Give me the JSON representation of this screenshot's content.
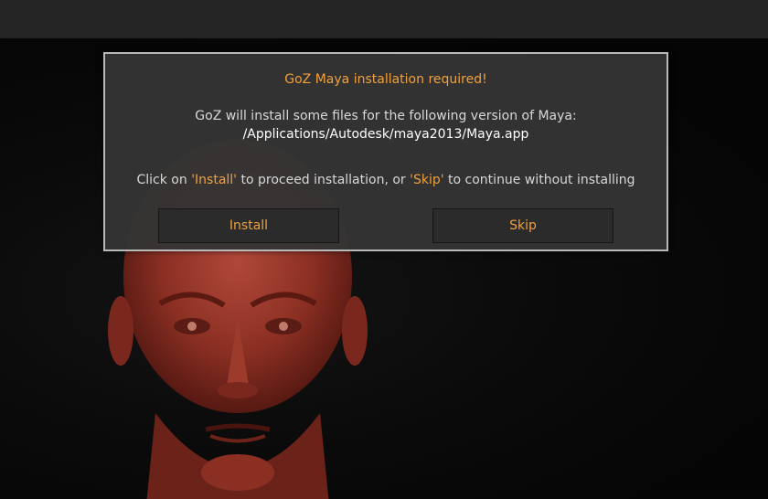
{
  "dialog": {
    "title": "GoZ Maya installation required!",
    "message": "GoZ will install some files for the following version of Maya:",
    "path": "/Applications/Autodesk/maya2013/Maya.app",
    "instruction": {
      "part1": "Click on ",
      "install_ref": "'Install'",
      "part2": " to proceed installation, or ",
      "skip_ref": "'Skip'",
      "part3": " to continue without installing"
    },
    "install_label": "Install",
    "skip_label": "Skip"
  },
  "colors": {
    "accent": "#f0a03c",
    "dialog_bg": "#343434",
    "dialog_border": "#b9b9b9",
    "model": "#8e2f22"
  },
  "icons": [
    "sculpted-head-model"
  ]
}
